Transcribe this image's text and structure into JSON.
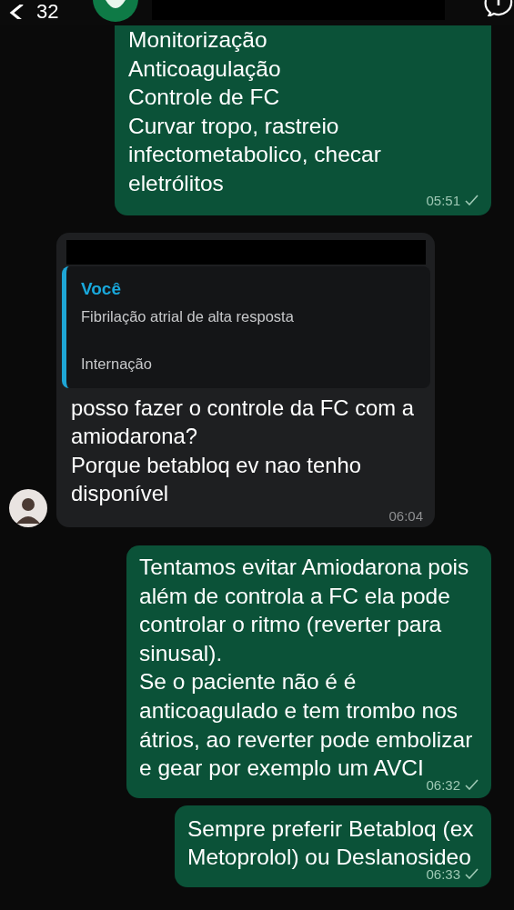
{
  "header": {
    "back_count": "32",
    "name_redacted": true
  },
  "messages": [
    {
      "kind": "outgoing",
      "text": "Monitorização\nAnticoagulação\nControle de FC\nCurvar tropo, rastreio infectometabolico, checar eletrólitos",
      "time": "05:51",
      "sent": true
    },
    {
      "kind": "incoming",
      "sender_redacted": true,
      "quote": {
        "author": "Você",
        "text": "Fibrilação atrial de alta resposta\n\nInternação"
      },
      "text": "posso fazer o controle da FC com a amiodarona?\nPorque betabloq ev nao tenho disponível",
      "time": "06:04",
      "avatar": true
    },
    {
      "kind": "outgoing",
      "text": "Tentamos evitar Amiodarona pois além de controla a FC ela pode controlar o ritmo (reverter para sinusal).\nSe o paciente não é é anticoagulado e tem trombo nos átrios, ao reverter pode embolizar e gear por exemplo um AVCI",
      "time": "06:32",
      "sent": true
    },
    {
      "kind": "outgoing",
      "text": "Sempre preferir Betabloq (ex Metoprolol) ou Deslanosideo",
      "time": "06:33",
      "sent": true
    }
  ]
}
